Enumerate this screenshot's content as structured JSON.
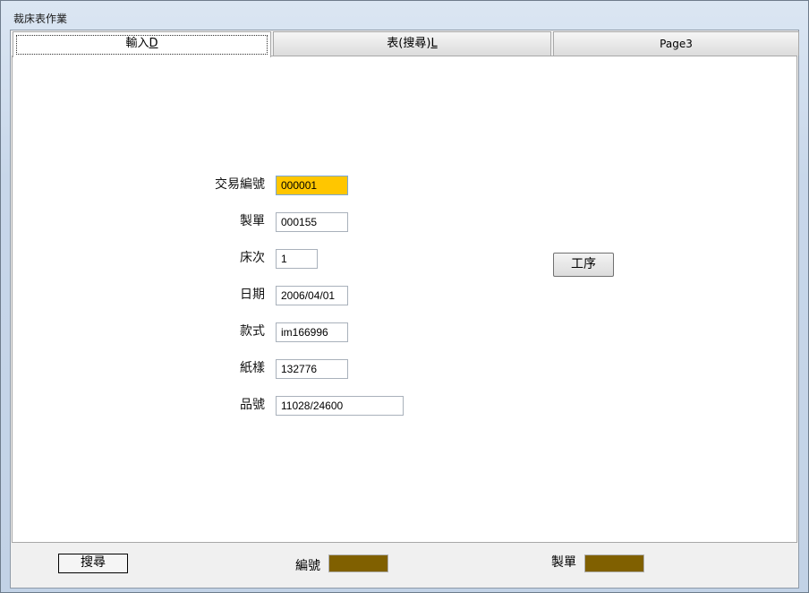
{
  "window": {
    "title": "裁床表作業"
  },
  "tabs": [
    {
      "label": "輸入",
      "accel": "D"
    },
    {
      "label": "表(搜尋)",
      "accel": "L"
    },
    {
      "label": "Page3"
    }
  ],
  "form": {
    "fields": [
      {
        "label": "交易編號",
        "value": "000001"
      },
      {
        "label": "製單",
        "value": "000155"
      },
      {
        "label": "床次",
        "value": "1"
      },
      {
        "label": "日期",
        "value": "2006/04/01"
      },
      {
        "label": "款式",
        "value": "im166996"
      },
      {
        "label": "紙樣",
        "value": "132776"
      },
      {
        "label": "品號",
        "value": "11028/24600"
      }
    ],
    "process_button": "工序"
  },
  "bottombar": {
    "search_button": "搜尋",
    "code_label": "編號",
    "order_label": "製單"
  },
  "colors": {
    "highlight_field": "#ffc600",
    "status_box": "#806000"
  }
}
